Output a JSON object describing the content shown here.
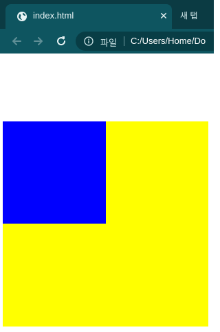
{
  "tab": {
    "title": "index.html",
    "close_glyph": "✕"
  },
  "new_tab": {
    "label": "새 탭"
  },
  "toolbar": {
    "scheme_label": "파일",
    "url": "C:/Users/Home/Do"
  },
  "icons": {
    "tab": "globe-icon",
    "back": "arrow-left-icon",
    "forward": "arrow-right-icon",
    "reload": "reload-icon",
    "info": "info-icon"
  },
  "colors": {
    "tab_strip": "#0b3b43",
    "toolbar": "#0e5560",
    "omnibox": "#083d45",
    "box_outer": "#ffff00",
    "box_inner": "#0000ff"
  }
}
